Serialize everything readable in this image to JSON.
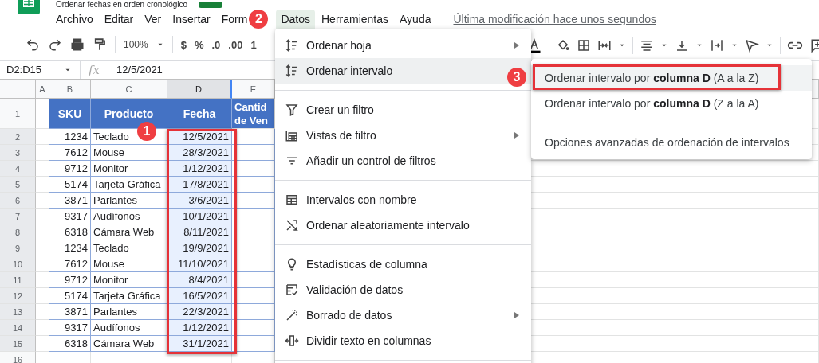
{
  "app": {
    "title": "Ordenar fechas en orden cronológico"
  },
  "menu_bar": [
    {
      "label": "Archivo",
      "selected": false
    },
    {
      "label": "Editar",
      "selected": false
    },
    {
      "label": "Ver",
      "selected": false
    },
    {
      "label": "Insertar",
      "selected": false
    },
    {
      "label": "Form",
      "selected": false
    },
    {
      "label": "Datos",
      "selected": true
    },
    {
      "label": "Herramientas",
      "selected": false
    },
    {
      "label": "Ayuda",
      "selected": false
    }
  ],
  "last_edit_link": "Última modificación hace unos segundos",
  "toolbar": {
    "zoom": "100%",
    "currency": "$",
    "percent": "%",
    "decimal_less": ".0",
    "decimal_more": ".00",
    "more_formats": "1"
  },
  "formula_bar": {
    "name_box": "D2:D15",
    "fx": "fx",
    "value": "12/5/2021"
  },
  "sheet": {
    "columns": [
      {
        "label": "A",
        "selected": false
      },
      {
        "label": "B",
        "selected": false
      },
      {
        "label": "C",
        "selected": false
      },
      {
        "label": "D",
        "selected": true
      },
      {
        "label": "E",
        "selected": false
      }
    ],
    "header_row": {
      "number": "1",
      "cells": [
        "SKU",
        "Producto",
        "Fecha"
      ],
      "cut_header_lines": [
        "Cantid",
        "de Ven"
      ]
    },
    "rows": [
      {
        "number": "2",
        "sku": "1234",
        "product": "Teclado",
        "date": "12/5/2021",
        "selected": true
      },
      {
        "number": "3",
        "sku": "7612",
        "product": "Mouse",
        "date": "28/3/2021",
        "selected": true
      },
      {
        "number": "4",
        "sku": "9712",
        "product": "Monitor",
        "date": "1/12/2021",
        "selected": true
      },
      {
        "number": "5",
        "sku": "5174",
        "product": "Tarjeta Gráfica",
        "date": "17/8/2021",
        "selected": true
      },
      {
        "number": "6",
        "sku": "3871",
        "product": "Parlantes",
        "date": "3/6/2021",
        "selected": true
      },
      {
        "number": "7",
        "sku": "9317",
        "product": "Audífonos",
        "date": "10/1/2021",
        "selected": true
      },
      {
        "number": "8",
        "sku": "6318",
        "product": "Cámara Web",
        "date": "8/11/2021",
        "selected": true
      },
      {
        "number": "9",
        "sku": "1234",
        "product": "Teclado",
        "date": "19/9/2021",
        "selected": true
      },
      {
        "number": "10",
        "sku": "7612",
        "product": "Mouse",
        "date": "11/10/2021",
        "selected": true
      },
      {
        "number": "11",
        "sku": "9712",
        "product": "Monitor",
        "date": "8/4/2021",
        "selected": true
      },
      {
        "number": "12",
        "sku": "5174",
        "product": "Tarjeta Gráfica",
        "date": "16/5/2021",
        "selected": true
      },
      {
        "number": "13",
        "sku": "3871",
        "product": "Parlantes",
        "date": "22/3/2021",
        "selected": true
      },
      {
        "number": "14",
        "sku": "9317",
        "product": "Audífonos",
        "date": "1/12/2021",
        "selected": true
      },
      {
        "number": "15",
        "sku": "6318",
        "product": "Cámara Web",
        "date": "31/1/2021",
        "selected": true
      },
      {
        "number": "16",
        "selected": false
      }
    ]
  },
  "data_menu": [
    {
      "kind": "item",
      "label": "Ordenar hoja",
      "submenu": true,
      "selected": false
    },
    {
      "kind": "item",
      "label": "Ordenar intervalo",
      "submenu": false,
      "selected": true
    },
    {
      "kind": "separator"
    },
    {
      "kind": "item",
      "label": "Crear un filtro",
      "submenu": false,
      "selected": false
    },
    {
      "kind": "item",
      "label": "Vistas de filtro",
      "submenu": true,
      "selected": false
    },
    {
      "kind": "item",
      "label": "Añadir un control de filtros",
      "submenu": false,
      "selected": false
    },
    {
      "kind": "separator"
    },
    {
      "kind": "item",
      "label": "Intervalos con nombre",
      "submenu": false,
      "selected": false
    },
    {
      "kind": "item",
      "label": "Ordenar aleatoriamente intervalo",
      "submenu": false,
      "selected": false
    },
    {
      "kind": "separator"
    },
    {
      "kind": "item",
      "label": "Estadísticas de columna",
      "submenu": false,
      "selected": false
    },
    {
      "kind": "item",
      "label": "Validación de datos",
      "submenu": false,
      "selected": false
    },
    {
      "kind": "item",
      "label": "Borrado de datos",
      "submenu": true,
      "selected": false
    },
    {
      "kind": "item",
      "label": "Dividir texto en columnas",
      "submenu": false,
      "selected": false
    },
    {
      "kind": "separator"
    }
  ],
  "sort_submenu": [
    {
      "kind": "item",
      "label": "Ordenar intervalo por **columna D** (A a la Z)",
      "selected": true
    },
    {
      "kind": "item",
      "label": "Ordenar intervalo por **columna D** (Z a la A)",
      "selected": false
    },
    {
      "kind": "separator"
    },
    {
      "kind": "item",
      "label": "Opciones avanzadas de ordenación de intervalos",
      "selected": false
    }
  ],
  "callouts": [
    "1",
    "2",
    "3"
  ]
}
